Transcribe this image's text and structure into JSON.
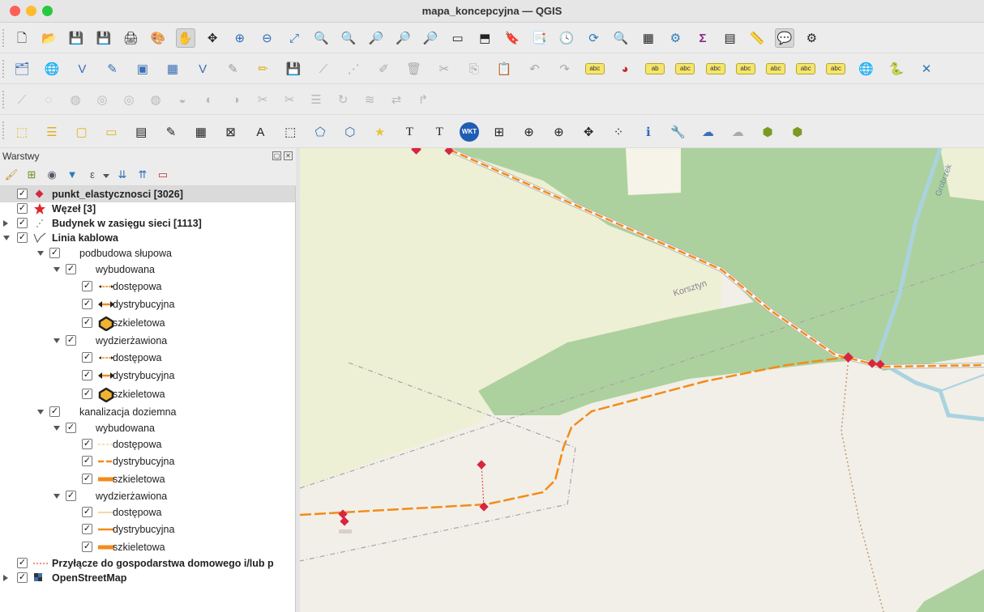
{
  "window": {
    "title": "mapa_koncepcyjna — QGIS"
  },
  "toolbars": {
    "row1": [
      "new-project-icon",
      "open-project-icon",
      "save-project-icon",
      "save-as-icon",
      "print-layout-icon",
      "style-manager-icon",
      "pan-icon",
      "pan-to-selection-icon",
      "zoom-in-icon",
      "zoom-out-icon",
      "zoom-full-icon",
      "zoom-to-selection-icon",
      "zoom-to-layer-icon",
      "zoom-native-icon",
      "zoom-last-icon",
      "zoom-next-icon",
      "new-map-view-icon",
      "new-3d-view-icon",
      "new-bookmark-icon",
      "show-bookmarks-icon",
      "temporal-controller-icon",
      "refresh-icon",
      "identify-icon",
      "statistics-icon",
      "processing-icon",
      "sum-icon",
      "attribute-table-icon",
      "measure-icon",
      "map-tips-icon",
      "settings-icon"
    ],
    "row2": [
      "data-source-manager-icon",
      "new-geopackage-icon",
      "new-shapefile-icon",
      "new-spatialite-icon",
      "new-virtual-layer-icon",
      "new-temporary-layer-icon",
      "new-mesh-icon",
      "edit-pencil-icon",
      "toggle-editing-icon",
      "save-edits-icon",
      "digitize-icon",
      "vertex-tool-icon",
      "modify-attributes-icon",
      "delete-selected-icon",
      "cut-features-icon",
      "copy-features-icon",
      "paste-features-icon",
      "undo-icon",
      "redo-icon",
      "label-icon",
      "diagram-icon",
      "label-pin-icon",
      "label-hide-icon",
      "label-show-icon",
      "label-move-icon",
      "label-rotate-icon",
      "label-change-icon",
      "label-edit-icon",
      "globe-icon",
      "python-icon",
      "snapping-icon"
    ],
    "row3": [
      "digitize-curve-icon",
      "add-ring-icon",
      "add-part-icon",
      "fill-ring-icon",
      "delete-ring-icon",
      "delete-part-icon",
      "reshape-icon",
      "offset-icon",
      "split-parts-icon",
      "split-features-icon",
      "merge-icon",
      "merge-attributes-icon",
      "rotate-point-icon",
      "simplify-icon",
      "reverse-line-icon",
      "trim-extend-icon"
    ],
    "row4": [
      "select-features-icon",
      "select-by-value-icon",
      "deselect-icon",
      "select-location-icon",
      "field-calculator-icon",
      "open-field-calc-icon",
      "open-table-icon",
      "georeferencer-icon",
      "add-text-annotation-icon",
      "select-annotation-icon",
      "node-tool-icon",
      "vertex-editor-icon",
      "favorite-star-icon",
      "add-text-icon",
      "text-format-icon",
      "wkt-icon",
      "snap-settings-icon",
      "crosshair-icon",
      "capture-coordinate-icon",
      "move-feature-icon",
      "point-cloud-icon",
      "info-icon",
      "tool-wrench-icon",
      "cloud-icon",
      "cloud-upload-icon",
      "3d-box-icon",
      "3d-box-settings-icon"
    ],
    "wkt_label": "WKT",
    "sum_label": "Σ",
    "text_label": "T"
  },
  "layers_panel": {
    "title": "Warstwy",
    "layers": [
      {
        "label": "punkt_elastycznosci [3026]",
        "bold": true,
        "checked": true,
        "expander": "none",
        "symbol": "red-diamond",
        "selected": true
      },
      {
        "label": "Węzeł [3]",
        "bold": true,
        "checked": true,
        "expander": "none",
        "symbol": "red-star"
      },
      {
        "label": "Budynek w zasięgu sieci [1113]",
        "bold": true,
        "checked": true,
        "expander": "right",
        "symbol": "points"
      },
      {
        "label": "Linia kablowa",
        "bold": true,
        "checked": true,
        "expander": "down",
        "symbol": "line-rules"
      },
      {
        "label": "podbudowa słupowa",
        "bold": false,
        "checked": true,
        "expander": "down",
        "symbol": "none"
      },
      {
        "label": "wybudowana",
        "bold": false,
        "checked": true,
        "expander": "down",
        "symbol": "none"
      },
      {
        "label": "dostępowa",
        "bold": false,
        "checked": true,
        "expander": "none",
        "symbol": "thin-arrow"
      },
      {
        "label": "dystrybucyjna",
        "bold": false,
        "checked": true,
        "expander": "none",
        "symbol": "mid-arrow"
      },
      {
        "label": "szkieletowa",
        "bold": false,
        "checked": true,
        "expander": "none",
        "symbol": "hexagon"
      },
      {
        "label": "wydzierżawiona",
        "bold": false,
        "checked": true,
        "expander": "down",
        "symbol": "none"
      },
      {
        "label": "dostępowa",
        "bold": false,
        "checked": true,
        "expander": "none",
        "symbol": "thin-arrow"
      },
      {
        "label": "dystrybucyjna",
        "bold": false,
        "checked": true,
        "expander": "none",
        "symbol": "mid-arrow"
      },
      {
        "label": "szkieletowa",
        "bold": false,
        "checked": true,
        "expander": "none",
        "symbol": "hexagon"
      },
      {
        "label": "kanalizacja doziemna",
        "bold": false,
        "checked": true,
        "expander": "down",
        "symbol": "none"
      },
      {
        "label": "wybudowana",
        "bold": false,
        "checked": true,
        "expander": "down",
        "symbol": "none"
      },
      {
        "label": "dostępowa",
        "bold": false,
        "checked": true,
        "expander": "none",
        "symbol": "thin-dash"
      },
      {
        "label": "dystrybucyjna",
        "bold": false,
        "checked": true,
        "expander": "none",
        "symbol": "mid-dash"
      },
      {
        "label": "szkieletowa",
        "bold": false,
        "checked": true,
        "expander": "none",
        "symbol": "thick-solid"
      },
      {
        "label": "wydzierżawiona",
        "bold": false,
        "checked": true,
        "expander": "down",
        "symbol": "none"
      },
      {
        "label": "dostępowa",
        "bold": false,
        "checked": true,
        "expander": "none",
        "symbol": "thin-solid"
      },
      {
        "label": "dystrybucyjna",
        "bold": false,
        "checked": true,
        "expander": "none",
        "symbol": "mid-solid"
      },
      {
        "label": "szkieletowa",
        "bold": false,
        "checked": true,
        "expander": "none",
        "symbol": "thick-solid"
      },
      {
        "label": "Przyłącze do gospodarstwa domowego i/lub p",
        "bold": true,
        "checked": true,
        "expander": "none",
        "symbol": "red-dotted"
      },
      {
        "label": "OpenStreetMap",
        "bold": true,
        "checked": true,
        "expander": "right",
        "symbol": "raster"
      }
    ]
  },
  "map": {
    "road_label": "Korsztyn",
    "stream_label": "Grobrzek",
    "colors": {
      "background": "#f2efe9",
      "forest": "#add19e",
      "field": "#eef0d5",
      "cable": "#f28c18",
      "point": "#d7263d",
      "water": "#aad3df"
    }
  }
}
